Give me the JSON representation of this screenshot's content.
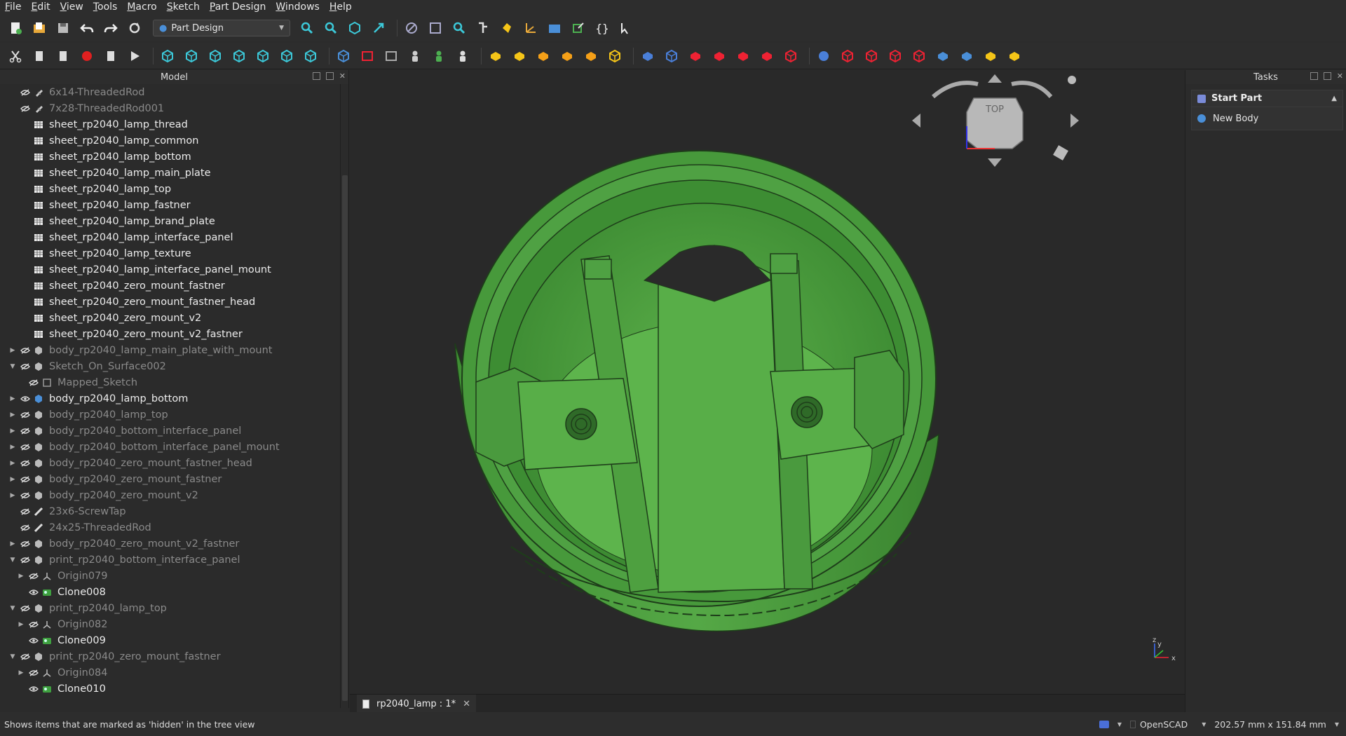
{
  "menu": [
    "File",
    "Edit",
    "View",
    "Tools",
    "Macro",
    "Sketch",
    "Part Design",
    "Windows",
    "Help"
  ],
  "workbench": {
    "selected": "Part Design"
  },
  "model_panel": {
    "title": "Model"
  },
  "tree": [
    {
      "label": "6x14-ThreadedRod",
      "hidden": true,
      "icon": "threaded-rod-icon",
      "indent": 0,
      "expander": "none"
    },
    {
      "label": "7x28-ThreadedRod001",
      "hidden": true,
      "icon": "threaded-rod-icon",
      "indent": 0,
      "expander": "none"
    },
    {
      "label": "sheet_rp2040_lamp_thread",
      "hidden": false,
      "icon": "spreadsheet-icon",
      "indent": 0,
      "expander": "none",
      "novis": true
    },
    {
      "label": "sheet_rp2040_lamp_common",
      "hidden": false,
      "icon": "spreadsheet-icon",
      "indent": 0,
      "expander": "none",
      "novis": true
    },
    {
      "label": "sheet_rp2040_lamp_bottom",
      "hidden": false,
      "icon": "spreadsheet-icon",
      "indent": 0,
      "expander": "none",
      "novis": true
    },
    {
      "label": "sheet_rp2040_lamp_main_plate",
      "hidden": false,
      "icon": "spreadsheet-icon",
      "indent": 0,
      "expander": "none",
      "novis": true
    },
    {
      "label": "sheet_rp2040_lamp_top",
      "hidden": false,
      "icon": "spreadsheet-icon",
      "indent": 0,
      "expander": "none",
      "novis": true
    },
    {
      "label": "sheet_rp2040_lamp_fastner",
      "hidden": false,
      "icon": "spreadsheet-icon",
      "indent": 0,
      "expander": "none",
      "novis": true
    },
    {
      "label": "sheet_rp2040_lamp_brand_plate",
      "hidden": false,
      "icon": "spreadsheet-icon",
      "indent": 0,
      "expander": "none",
      "novis": true
    },
    {
      "label": "sheet_rp2040_lamp_interface_panel",
      "hidden": false,
      "icon": "spreadsheet-icon",
      "indent": 0,
      "expander": "none",
      "novis": true
    },
    {
      "label": "sheet_rp2040_lamp_texture",
      "hidden": false,
      "icon": "spreadsheet-icon",
      "indent": 0,
      "expander": "none",
      "novis": true
    },
    {
      "label": "sheet_rp2040_lamp_interface_panel_mount",
      "hidden": false,
      "icon": "spreadsheet-icon",
      "indent": 0,
      "expander": "none",
      "novis": true
    },
    {
      "label": "sheet_rp2040_zero_mount_fastner",
      "hidden": false,
      "icon": "spreadsheet-icon",
      "indent": 0,
      "expander": "none",
      "novis": true
    },
    {
      "label": "sheet_rp2040_zero_mount_fastner_head",
      "hidden": false,
      "icon": "spreadsheet-icon",
      "indent": 0,
      "expander": "none",
      "novis": true
    },
    {
      "label": "sheet_rp2040_zero_mount_v2",
      "hidden": false,
      "icon": "spreadsheet-icon",
      "indent": 0,
      "expander": "none",
      "novis": true
    },
    {
      "label": "sheet_rp2040_zero_mount_v2_fastner",
      "hidden": false,
      "icon": "spreadsheet-icon",
      "indent": 0,
      "expander": "none",
      "novis": true
    },
    {
      "label": "body_rp2040_lamp_main_plate_with_mount",
      "hidden": true,
      "icon": "body-icon",
      "indent": 0,
      "expander": "collapsed"
    },
    {
      "label": "Sketch_On_Surface002",
      "hidden": true,
      "icon": "body-icon",
      "indent": 0,
      "expander": "expanded"
    },
    {
      "label": "Mapped_Sketch",
      "hidden": true,
      "icon": "sketch-icon",
      "indent": 1,
      "expander": "none"
    },
    {
      "label": "body_rp2040_lamp_bottom",
      "hidden": false,
      "icon": "active-body-icon",
      "indent": 0,
      "expander": "collapsed"
    },
    {
      "label": "body_rp2040_lamp_top",
      "hidden": true,
      "icon": "body-icon",
      "indent": 0,
      "expander": "collapsed"
    },
    {
      "label": "body_rp2040_bottom_interface_panel",
      "hidden": true,
      "icon": "body-icon",
      "indent": 0,
      "expander": "collapsed"
    },
    {
      "label": "body_rp2040_bottom_interface_panel_mount",
      "hidden": true,
      "icon": "body-icon",
      "indent": 0,
      "expander": "collapsed"
    },
    {
      "label": "body_rp2040_zero_mount_fastner_head",
      "hidden": true,
      "icon": "body-icon",
      "indent": 0,
      "expander": "collapsed"
    },
    {
      "label": "body_rp2040_zero_mount_fastner",
      "hidden": true,
      "icon": "body-icon",
      "indent": 0,
      "expander": "collapsed"
    },
    {
      "label": "body_rp2040_zero_mount_v2",
      "hidden": true,
      "icon": "body-icon",
      "indent": 0,
      "expander": "collapsed"
    },
    {
      "label": "23x6-ScrewTap",
      "hidden": true,
      "icon": "screwtap-icon",
      "indent": 0,
      "expander": "none"
    },
    {
      "label": "24x25-ThreadedRod",
      "hidden": true,
      "icon": "screwtap-icon",
      "indent": 0,
      "expander": "none"
    },
    {
      "label": "body_rp2040_zero_mount_v2_fastner",
      "hidden": true,
      "icon": "body-icon",
      "indent": 0,
      "expander": "collapsed"
    },
    {
      "label": "print_rp2040_bottom_interface_panel",
      "hidden": true,
      "icon": "body-icon",
      "indent": 0,
      "expander": "expanded"
    },
    {
      "label": "Origin079",
      "hidden": true,
      "icon": "origin-icon",
      "indent": 1,
      "expander": "collapsed"
    },
    {
      "label": "Clone008",
      "hidden": false,
      "icon": "clone-icon",
      "indent": 1,
      "expander": "none"
    },
    {
      "label": "print_rp2040_lamp_top",
      "hidden": true,
      "icon": "body-icon",
      "indent": 0,
      "expander": "expanded"
    },
    {
      "label": "Origin082",
      "hidden": true,
      "icon": "origin-icon",
      "indent": 1,
      "expander": "collapsed"
    },
    {
      "label": "Clone009",
      "hidden": false,
      "icon": "clone-icon",
      "indent": 1,
      "expander": "none"
    },
    {
      "label": "print_rp2040_zero_mount_fastner",
      "hidden": true,
      "icon": "body-icon",
      "indent": 0,
      "expander": "expanded"
    },
    {
      "label": "Origin084",
      "hidden": true,
      "icon": "origin-icon",
      "indent": 1,
      "expander": "collapsed"
    },
    {
      "label": "Clone010",
      "hidden": false,
      "icon": "clone-icon",
      "indent": 1,
      "expander": "none"
    }
  ],
  "viewport": {
    "navcube_face": "TOP",
    "model_color": "#4a9a3e",
    "axis_labels": {
      "z": "z",
      "y": "y",
      "x": "x"
    }
  },
  "document_tab": {
    "label": "rp2040_lamp : 1*"
  },
  "tasks_panel": {
    "title": "Tasks",
    "section_title": "Start Part",
    "item": "New Body"
  },
  "status": {
    "message": "Shows items that are marked as 'hidden' in the tree view",
    "navigation": "OpenSCAD",
    "dimensions": "202.57 mm x 151.84 mm"
  }
}
